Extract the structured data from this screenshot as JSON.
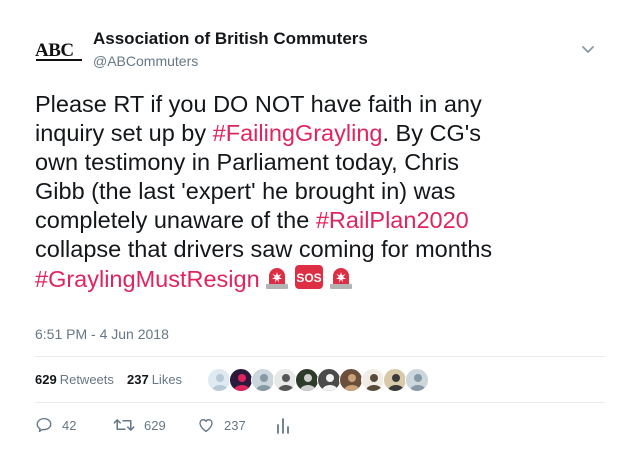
{
  "author": {
    "logo_text": "ABC",
    "name": "Association of British Commuters",
    "handle": "@ABCommuters"
  },
  "tweet": {
    "lines": [
      [
        {
          "t": "Please RT if you DO NOT have faith in any"
        }
      ],
      [
        {
          "t": "inquiry set up by "
        },
        {
          "t": "#FailingGrayling",
          "tag": true
        },
        {
          "t": ". By CG's"
        }
      ],
      [
        {
          "t": "own testimony in Parliament today, Chris"
        }
      ],
      [
        {
          "t": "Gibb (the last 'expert' he brought in) was"
        }
      ],
      [
        {
          "t": "completely unaware of the "
        },
        {
          "t": "#RailPlan2020",
          "tag": true
        }
      ],
      [
        {
          "t": "collapse that drivers saw coming for months"
        }
      ],
      [
        {
          "t": "#GraylingMustResign",
          "tag": true
        },
        {
          "emoji": "rotating-light"
        },
        {
          "emoji": "sos"
        },
        {
          "emoji": "rotating-light"
        }
      ]
    ],
    "timestamp": "6:51 PM - 4 Jun 2018"
  },
  "stats": {
    "retweets_count": "629",
    "retweets_label": "Retweets",
    "likes_count": "237",
    "likes_label": "Likes"
  },
  "likers": [
    {
      "name": "avatar-1",
      "color": "#dfe9f1",
      "accent": "#b9c9d6"
    },
    {
      "name": "avatar-2",
      "color": "#2b1a3b",
      "accent": "#e0245e"
    },
    {
      "name": "avatar-3",
      "color": "#ccd6dd",
      "accent": "#8899a6"
    },
    {
      "name": "avatar-4",
      "color": "#e8e8e8",
      "accent": "#555555"
    },
    {
      "name": "avatar-5",
      "color": "#2e3b2a",
      "accent": "#cfcfcf"
    },
    {
      "name": "avatar-6",
      "color": "#4a4a4a",
      "accent": "#f2f2f2"
    },
    {
      "name": "avatar-7",
      "color": "#6b4f3a",
      "accent": "#c9a27a"
    },
    {
      "name": "avatar-8",
      "color": "#f1ede6",
      "accent": "#5a4a3a"
    },
    {
      "name": "avatar-9",
      "color": "#d8c9a8",
      "accent": "#3a3a3a"
    },
    {
      "name": "avatar-10",
      "color": "#ccd6dd",
      "accent": "#8899a6"
    }
  ],
  "actions": {
    "reply_count": "42",
    "retweet_count": "629",
    "like_count": "237"
  },
  "colors": {
    "hashtag": "#e0245e",
    "muted": "#657786",
    "text": "#14171a",
    "divider": "#e6ecf0",
    "emoji_red": "#dd2e44"
  },
  "icons": [
    "chevron-down-icon",
    "reply-icon",
    "retweet-icon",
    "heart-icon",
    "analytics-icon",
    "rotating-light-emoji",
    "sos-emoji"
  ]
}
